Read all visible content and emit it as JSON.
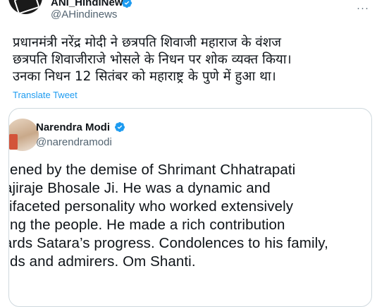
{
  "author": {
    "display_name": "ANI_HindiNews",
    "handle": "@AHindinews",
    "avatar_icon": "ani-logo"
  },
  "tweet": {
    "lines": [
      "प्रधानमंत्री नरेंद्र मोदी ने छत्रपति शिवाजी महाराज के वंशज",
      "छत्रपति शिवाजीराजे भोसले के निधन पर शोक व्यक्त किया।",
      "उनका निधन 12 सितंबर को महाराष्ट्र के पुणे में हुआ था।"
    ],
    "translate_label": "Translate Tweet"
  },
  "quoted": {
    "display_name": "Narendra Modi",
    "handle": "@narendramodi",
    "lines": [
      "ddened by the demise of Shrimant Chhatrapati",
      "ivajiraje Bhosale Ji. He was a dynamic and",
      "ultifaceted personality who worked extensively",
      "nong the people. He made a rich contribution",
      "wards Satara’s progress. Condolences to his family,",
      "ends and admirers. Om Shanti."
    ]
  },
  "colors": {
    "verified": "#1d9bf0",
    "link": "#1d9bf0",
    "secondary_text": "#536471",
    "border": "#cfd9de"
  }
}
